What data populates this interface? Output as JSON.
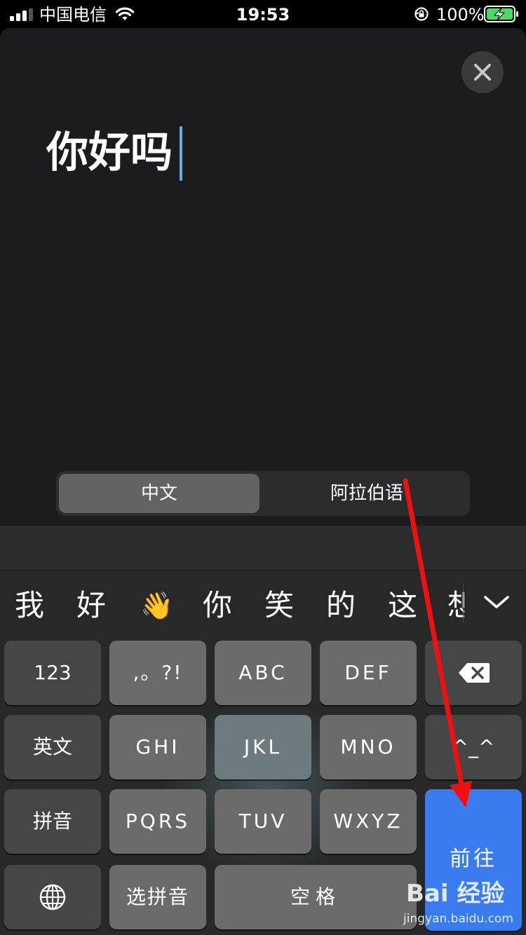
{
  "status_bar": {
    "carrier": "中国电信",
    "time": "19:53",
    "battery": "100%"
  },
  "input": {
    "text": "你好吗"
  },
  "language_toggle": {
    "source": "中文",
    "target": "阿拉伯语",
    "selected": "source"
  },
  "candidates": [
    "我",
    "好",
    "👋",
    "你",
    "笑",
    "的",
    "这",
    "想"
  ],
  "keyboard": {
    "row1": [
      "123",
      ",。?!",
      "ABC",
      "DEF"
    ],
    "row2": [
      "英文",
      "GHI",
      "JKL",
      "MNO",
      "^_^"
    ],
    "row3": [
      "拼音",
      "PQRS",
      "TUV",
      "WXYZ"
    ],
    "row4_select": "选拼音",
    "row4_space": "空格",
    "go": "前往"
  },
  "watermark": {
    "logo": "Bai 经验",
    "site": "jingyan.baidu.com"
  },
  "colors": {
    "accent_blue": "#3b7bf0",
    "caret": "#5fb3dc",
    "arrow": "#ee1111"
  }
}
